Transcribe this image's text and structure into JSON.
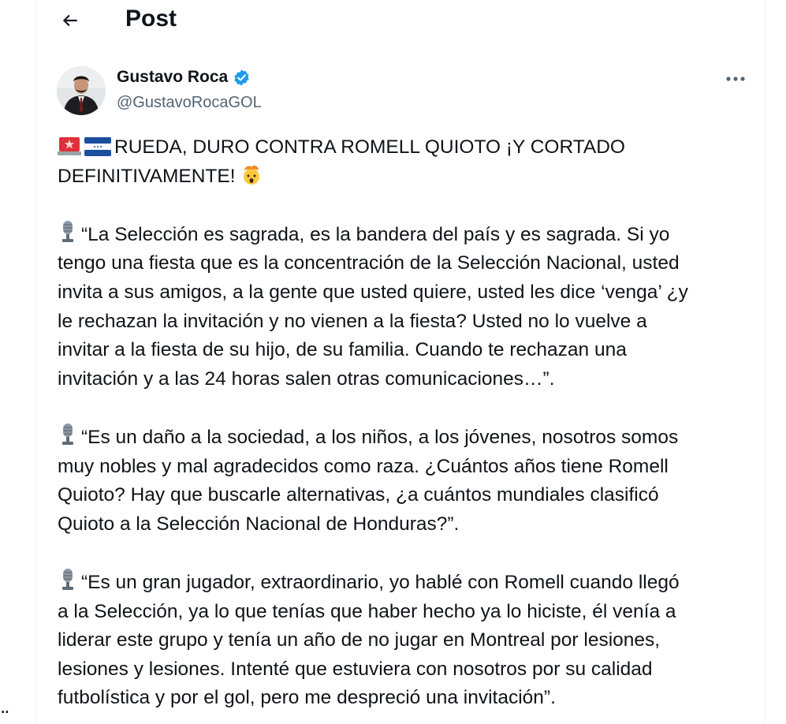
{
  "header": {
    "title": "Post"
  },
  "author": {
    "name": "Gustavo Roca",
    "handle": "@GustavoRocaGOL",
    "verified": true
  },
  "post": {
    "headline_line1": "RUEDA, DURO CONTRA ROMELL QUIOTO ¡Y CORTADO",
    "headline_line2": "DEFINITIVAMENTE!",
    "quote1": [
      "“La Selección es sagrada, es la bandera del país y es sagrada. Si yo",
      "tengo una fiesta que es la concentración de la Selección Nacional, usted",
      "invita a sus amigos, a la gente que usted quiere, usted les dice ‘venga’ ¿y",
      "le rechazan la invitación y no vienen a la fiesta? Usted no lo vuelve a",
      "invitar a la fiesta de su hijo, de su familia. Cuando te rechazan una",
      "invitación y a las 24 horas salen otras comunicaciones…”."
    ],
    "quote2": [
      "“Es un daño a la sociedad, a los niños, a los jóvenes, nosotros somos",
      "muy nobles y mal agradecidos como raza. ¿Cuántos años tiene Romell",
      "Quioto? Hay que buscarle alternativas, ¿a cuántos mundiales clasificó",
      "Quioto a la Selección Nacional de Honduras?”."
    ],
    "quote3": [
      "“Es un gran jugador, extraordinario, yo hablé con Romell cuando llegó",
      "a la Selección, ya lo que tenías que haber hecho ya lo hiciste, él venía a",
      "liderar este grupo y tenía un año de no jugar en Montreal por lesiones,",
      "lesiones y lesiones. Intenté que estuviera con nosotros por su calidad",
      "futbolística y por el gol, pero me despreció una invitación”."
    ]
  },
  "icons": {
    "back": "arrow-left-icon",
    "verified": "verified-badge-icon",
    "more": "more-horizontal-icon",
    "siren": "police-light-emoji",
    "flag": "honduras-flag-emoji",
    "mind_blown": "exploding-head-emoji",
    "microphone": "studio-microphone-emoji"
  },
  "colors": {
    "verified_blue": "#1d9bf0",
    "secondary_text": "#536471"
  },
  "edge_text": ".."
}
